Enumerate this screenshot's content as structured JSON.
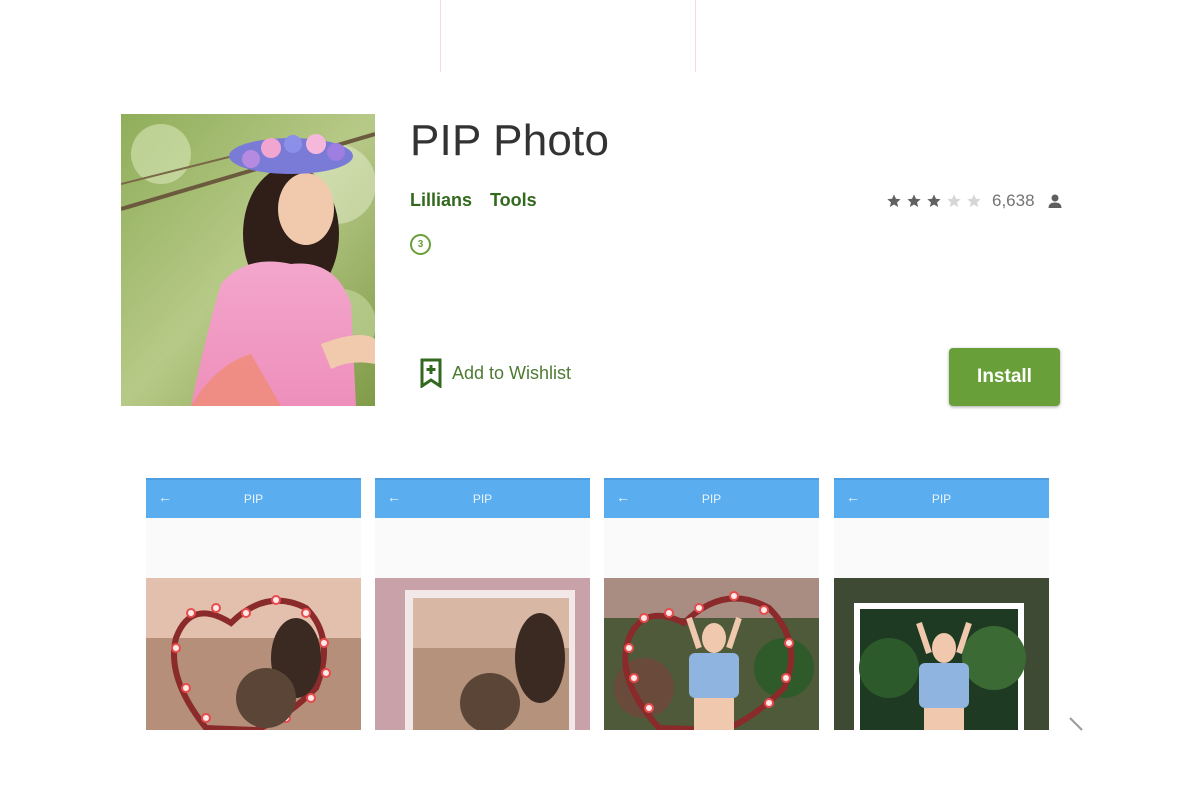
{
  "app": {
    "title": "PIP Photo",
    "developer": "Lillians",
    "category": "Tools",
    "content_rating_badge": "3",
    "rating": 3,
    "rating_max": 5,
    "rating_count": "6,638",
    "wishlist_label": "Add to Wishlist",
    "install_label": "Install"
  },
  "screenshots": [
    {
      "title": "PIP",
      "back": "←"
    },
    {
      "title": "PIP",
      "back": "←"
    },
    {
      "title": "PIP",
      "back": "←"
    },
    {
      "title": "PIP",
      "back": "←"
    }
  ],
  "colors": {
    "brand_green": "#689f38",
    "link_green": "#33691e",
    "toolbar_blue": "#5aaef0"
  },
  "icons": [
    "star-icon",
    "user-icon",
    "wishlist-bookmark-icon",
    "back-arrow-icon"
  ]
}
